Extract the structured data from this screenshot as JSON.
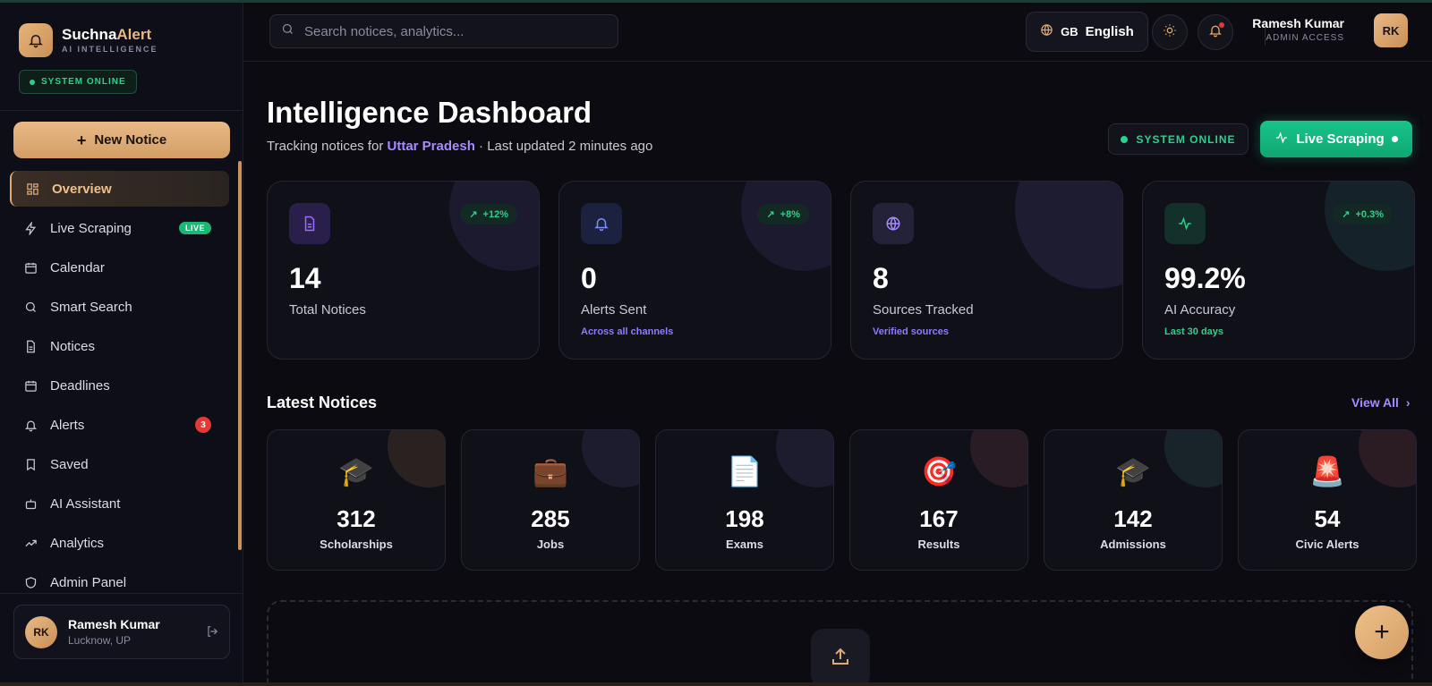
{
  "brand": {
    "name_part1": "Suchna",
    "name_part2": "Alert",
    "tagline": "AI INTELLIGENCE",
    "status": "SYSTEM ONLINE"
  },
  "sidebar": {
    "new_notice_label": "New Notice",
    "items": [
      {
        "label": "Overview",
        "icon": "grid-icon"
      },
      {
        "label": "Live Scraping",
        "icon": "bolt-icon",
        "badge": "LIVE"
      },
      {
        "label": "Calendar",
        "icon": "calendar-icon"
      },
      {
        "label": "Smart Search",
        "icon": "search-icon"
      },
      {
        "label": "Notices",
        "icon": "document-icon"
      },
      {
        "label": "Deadlines",
        "icon": "calendar-icon"
      },
      {
        "label": "Alerts",
        "icon": "bell-icon",
        "count": "3"
      },
      {
        "label": "Saved",
        "icon": "bookmark-icon"
      },
      {
        "label": "AI Assistant",
        "icon": "bot-icon"
      },
      {
        "label": "Analytics",
        "icon": "trend-icon"
      },
      {
        "label": "Admin Panel",
        "icon": "shield-icon"
      }
    ],
    "user": {
      "initials": "RK",
      "name": "Ramesh Kumar",
      "location": "Lucknow, UP"
    }
  },
  "topbar": {
    "search_placeholder": "Search notices, analytics...",
    "lang_code": "GB",
    "language": "English",
    "user_name": "Ramesh Kumar",
    "user_role": "ADMIN ACCESS",
    "user_initials": "RK"
  },
  "header": {
    "title": "Intelligence Dashboard",
    "subtitle_prefix": "Tracking notices for",
    "region": "Uttar Pradesh",
    "subtitle_suffix": "· Last updated 2 minutes ago",
    "status": "SYSTEM ONLINE",
    "live_button": "Live Scraping"
  },
  "stats": [
    {
      "value": "14",
      "label": "Total Notices",
      "change": "+12%",
      "sub": "",
      "icon": "document-icon"
    },
    {
      "value": "0",
      "label": "Alerts Sent",
      "change": "+8%",
      "sub": "Across all channels",
      "icon": "bell-icon"
    },
    {
      "value": "8",
      "label": "Sources Tracked",
      "change": "",
      "sub": "Verified sources",
      "icon": "globe-icon"
    },
    {
      "value": "99.2%",
      "label": "AI Accuracy",
      "change": "+0.3%",
      "sub": "Last 30 days",
      "icon": "pulse-icon"
    }
  ],
  "latest": {
    "title": "Latest Notices",
    "view_all": "View All",
    "categories": [
      {
        "emoji": "🎓",
        "value": "312",
        "label": "Scholarships"
      },
      {
        "emoji": "💼",
        "value": "285",
        "label": "Jobs"
      },
      {
        "emoji": "📄",
        "value": "198",
        "label": "Exams"
      },
      {
        "emoji": "🎯",
        "value": "167",
        "label": "Results"
      },
      {
        "emoji": "🎓",
        "value": "142",
        "label": "Admissions"
      },
      {
        "emoji": "🚨",
        "value": "54",
        "label": "Civic Alerts"
      }
    ]
  },
  "colors": {
    "accent": "#e0a96d",
    "success": "#19c38a",
    "link": "#a58bff",
    "danger": "#e53935"
  }
}
